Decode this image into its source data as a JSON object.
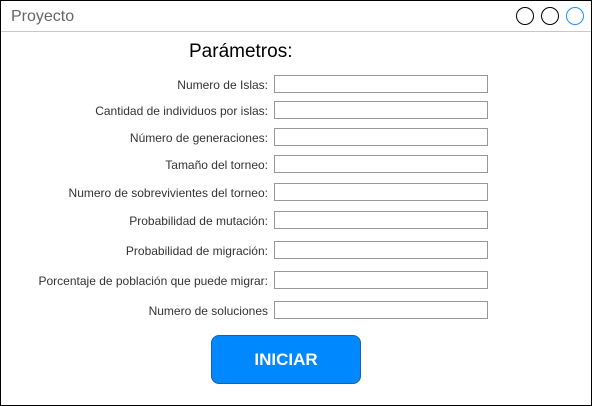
{
  "window": {
    "title": "Proyecto",
    "controls": [
      "minimize-icon",
      "maximize-icon",
      "close-icon"
    ]
  },
  "form": {
    "heading": "Parámetros:",
    "fields": [
      {
        "label": "Numero de Islas:",
        "value": ""
      },
      {
        "label": "Cantidad de individuos por islas:",
        "value": ""
      },
      {
        "label": "Número de generaciones:",
        "value": ""
      },
      {
        "label": "Tamaño del torneo:",
        "value": ""
      },
      {
        "label": "Numero de sobrevivientes del torneo:",
        "value": ""
      },
      {
        "label": "Probabilidad de mutación:",
        "value": ""
      },
      {
        "label": "Probabilidad de migración:",
        "value": ""
      },
      {
        "label": "Porcentaje de población que puede migrar:",
        "value": ""
      },
      {
        "label": "Numero de soluciones",
        "value": ""
      }
    ],
    "submit_label": "INICIAR"
  },
  "colors": {
    "button": "#0088ff",
    "button_text": "#ffffff",
    "close_ring": "#1e90ff"
  }
}
